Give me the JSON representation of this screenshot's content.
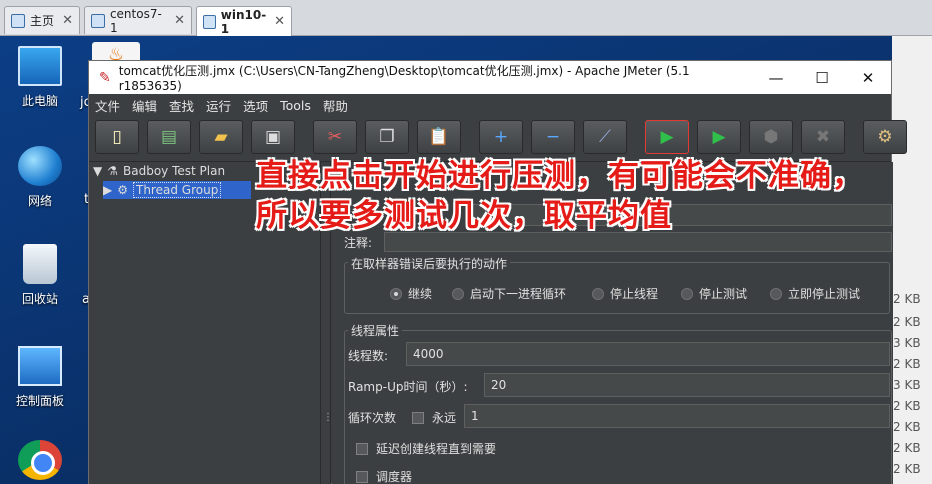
{
  "vm_tabs": [
    {
      "label": "主页"
    },
    {
      "label": "centos7-1"
    },
    {
      "label": "win10-1"
    }
  ],
  "desktop_icons": [
    "此电脑",
    "网络",
    "回收站",
    "控制面板"
  ],
  "stray_text": [
    "jc",
    "t",
    "a"
  ],
  "window": {
    "title": "tomcat优化压测.jmx (C:\\Users\\CN-TangZheng\\Desktop\\tomcat优化压测.jmx) - Apache JMeter (5.1 r1853635)",
    "minimize": "—",
    "maximize": "☐",
    "close": "✕"
  },
  "menu": [
    "文件",
    "编辑",
    "查找",
    "运行",
    "选项",
    "Tools",
    "帮助"
  ],
  "toolbar": [
    "new-icon",
    "template-icon",
    "open-icon",
    "save-icon",
    "cut-icon",
    "copy-icon",
    "paste-icon",
    "expand-icon",
    "collapse-icon",
    "toggle-icon",
    "start-icon",
    "start-no-pause-icon",
    "stop-icon",
    "shutdown-icon",
    "settings-icon"
  ],
  "tree": {
    "root": "Badboy Test Plan",
    "child": "Thread Group"
  },
  "panel": {
    "comment_label": "注释:",
    "error_group_label": "在取样器错误后要执行的动作",
    "error_options": [
      "继续",
      "启动下一进程循环",
      "停止线程",
      "停止测试",
      "立即停止测试"
    ],
    "thread_group_label": "线程属性",
    "threads_label": "线程数:",
    "threads_value": "4000",
    "rampup_label": "Ramp-Up时间（秒）:",
    "rampup_value": "20",
    "loop_label": "循环次数",
    "forever_label": "永远",
    "loop_value": "1",
    "delay_label": "延迟创建线程直到需要",
    "scheduler_label": "调度器"
  },
  "right_sizes": [
    "2 KB",
    "2 KB",
    "3 KB",
    "2 KB",
    "3 KB",
    "2 KB",
    "2 KB",
    "2 KB",
    "2 KB"
  ],
  "annotation": {
    "line1": "直接点击开始进行压测，有可能会不准确，",
    "line2": "所以要多测试几次，取平均值"
  }
}
